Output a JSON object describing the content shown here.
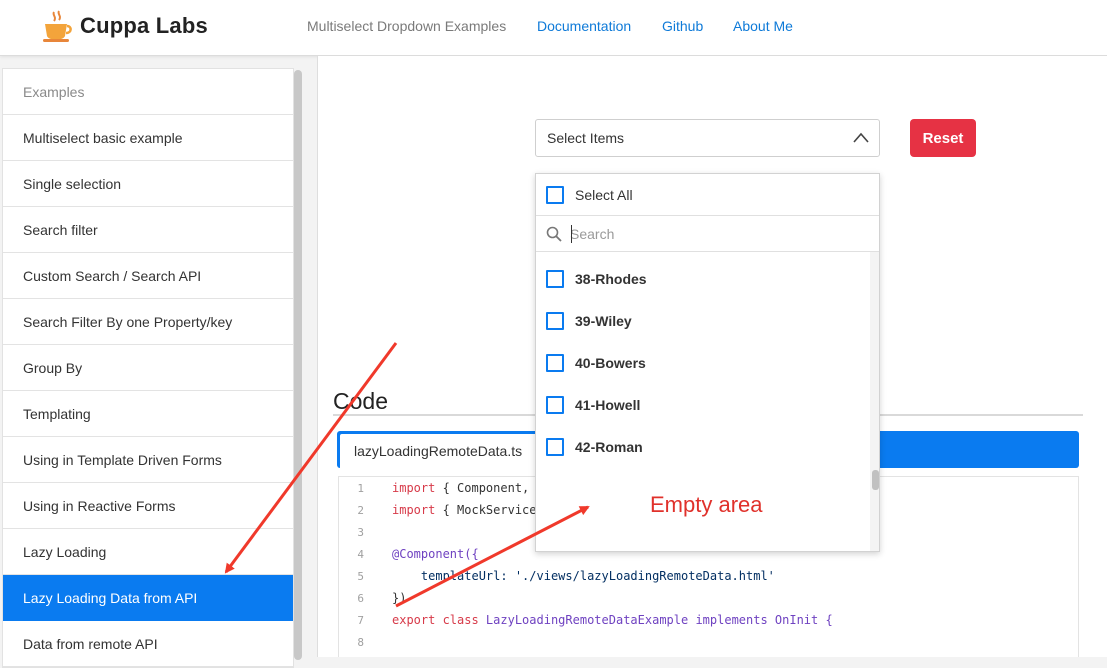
{
  "brand": {
    "name": "Cuppa Labs",
    "logo_icon": "coffee-cup-icon"
  },
  "nav": {
    "title": "Multiselect Dropdown Examples",
    "links": [
      "Documentation",
      "Github",
      "About Me"
    ]
  },
  "sidebar": {
    "header": "Examples",
    "items": [
      "Multiselect basic example",
      "Single selection",
      "Search filter",
      "Custom Search / Search API",
      "Search Filter By one Property/key",
      "Group By",
      "Templating",
      "Using in Template Driven Forms",
      "Using in Reactive Forms",
      "Lazy Loading",
      "Lazy Loading Data from API",
      "Data from remote API"
    ],
    "active_item": "Lazy Loading Data from API"
  },
  "multiselect": {
    "placeholder": "Select Items",
    "select_all_label": "Select All",
    "search_placeholder": "Search",
    "options": [
      "38-Rhodes",
      "39-Wiley",
      "40-Bowers",
      "41-Howell",
      "42-Roman"
    ]
  },
  "reset_button": {
    "label": "Reset"
  },
  "code": {
    "heading": "Code",
    "tab_label": "lazyLoadingRemoteData.ts",
    "lines": [
      {
        "n": "1",
        "kw": "import",
        "rest": " { Component,"
      },
      {
        "n": "2",
        "kw": "import",
        "rest": " { MockService"
      },
      {
        "n": "3",
        "kw": "",
        "rest": ""
      },
      {
        "n": "4",
        "kw": "",
        "rest": "@Component({"
      },
      {
        "n": "5",
        "kw": "",
        "rest": "    templateUrl: './views/lazyLoadingRemoteData.html'"
      },
      {
        "n": "6",
        "kw": "",
        "rest": "})"
      },
      {
        "n": "7",
        "kw": "export class",
        "rest": " LazyLoadingRemoteDataExample implements OnInit {"
      },
      {
        "n": "8",
        "kw": "",
        "rest": ""
      }
    ]
  },
  "annotation": {
    "text": "Empty area",
    "color": "#e0312b"
  },
  "colors": {
    "accent": "#0a7bf0",
    "danger": "#e63244",
    "link": "#0e7ad8"
  }
}
